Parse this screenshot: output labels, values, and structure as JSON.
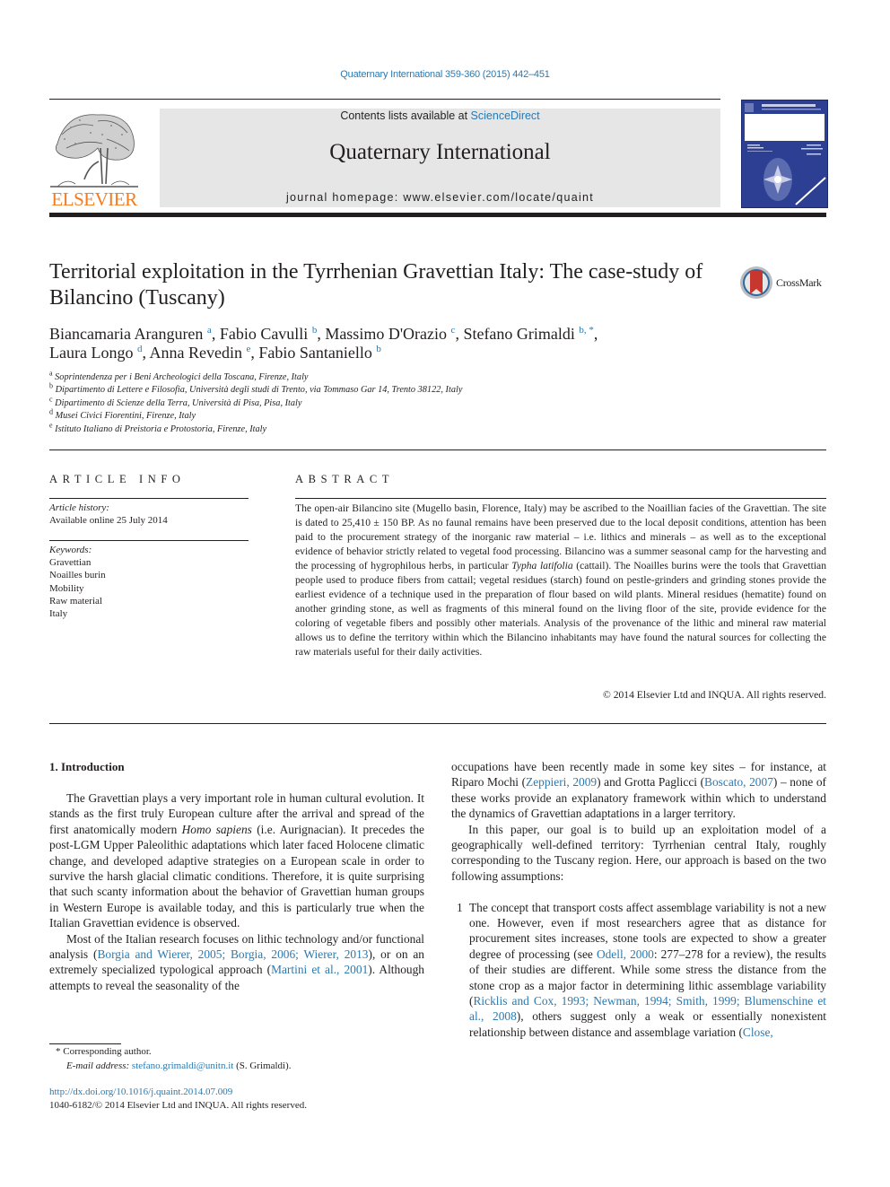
{
  "header": {
    "journal_ref": "Quaternary International 359-360 (2015) 442–451",
    "contents_prefix": "Contents lists available at ",
    "contents_link": "ScienceDirect",
    "journal_title": "Quaternary International",
    "homepage_prefix": "journal homepage: ",
    "homepage_url": "www.elsevier.com/locate/quaint",
    "publisher_logo_text": "ELSEVIER",
    "publisher_color": "#f47b20",
    "link_color": "#2a7ab0",
    "cover_color": "#2d3f93"
  },
  "article": {
    "title": "Territorial exploitation in the Tyrrhenian Gravettian Italy: The case-study of Bilancino (Tuscany)",
    "crossmark_label": "CrossMark",
    "authors": [
      {
        "name": "Biancamaria Aranguren",
        "aff": "a",
        "sep": ", "
      },
      {
        "name": "Fabio Cavulli",
        "aff": "b",
        "sep": ", "
      },
      {
        "name": "Massimo D'Orazio",
        "aff": "c",
        "sep": ", "
      },
      {
        "name": "Stefano Grimaldi",
        "aff": "b, *",
        "sep": ","
      },
      {
        "name": "Laura Longo",
        "aff": "d",
        "sep": ", "
      },
      {
        "name": "Anna Revedin",
        "aff": "e",
        "sep": ", "
      },
      {
        "name": "Fabio Santaniello",
        "aff": "b",
        "sep": ""
      }
    ],
    "affiliations": [
      {
        "key": "a",
        "text": "Soprintendenza per i Beni Archeologici della Toscana, Firenze, Italy"
      },
      {
        "key": "b",
        "text": "Dipartimento di Lettere e Filosofia, Università degli studi di Trento, via Tommaso Gar 14, Trento 38122, Italy"
      },
      {
        "key": "c",
        "text": "Dipartimento di Scienze della Terra, Università di Pisa, Pisa, Italy"
      },
      {
        "key": "d",
        "text": "Musei Civici Fiorentini, Firenze, Italy"
      },
      {
        "key": "e",
        "text": "Istituto Italiano di Preistoria e Protostoria, Firenze, Italy"
      }
    ]
  },
  "article_info": {
    "heading": "ARTICLE INFO",
    "history_label": "Article history:",
    "history_value": "Available online 25 July 2014",
    "keywords_label": "Keywords:",
    "keywords": [
      "Gravettian",
      "Noailles burin",
      "Mobility",
      "Raw material",
      "Italy"
    ]
  },
  "abstract": {
    "heading": "ABSTRACT",
    "text_before_italic": "The open-air Bilancino site (Mugello basin, Florence, Italy) may be ascribed to the Noaillian facies of the Gravettian. The site is dated to 25,410 ± 150 BP. As no faunal remains have been preserved due to the local deposit conditions, attention has been paid to the procurement strategy of the inorganic raw material – i.e. lithics and minerals – as well as to the exceptional evidence of behavior strictly related to vegetal food processing. Bilancino was a summer seasonal camp for the harvesting and the processing of hygrophilous herbs, in particular ",
    "italic": "Typha latifolia",
    "text_after_italic": " (cattail). The Noailles burins were the tools that Gravettian people used to produce fibers from cattail; vegetal residues (starch) found on pestle-grinders and grinding stones provide the earliest evidence of a technique used in the preparation of flour based on wild plants. Mineral residues (hematite) found on another grinding stone, as well as fragments of this mineral found on the living floor of the site, provide evidence for the coloring of vegetable fibers and possibly other materials. Analysis of the provenance of the lithic and mineral raw material allows us to define the territory within which the Bilancino inhabitants may have found the natural sources for collecting the raw materials useful for their daily activities.",
    "copyright": "© 2014 Elsevier Ltd and INQUA. All rights reserved."
  },
  "body": {
    "intro_heading": "1.  Introduction",
    "left_p1_a": "The Gravettian plays a very important role in human cultural evolution. It stands as the first truly European culture after the arrival and spread of the first anatomically modern ",
    "left_p1_italic": "Homo sapiens",
    "left_p1_b": " (i.e. Aurignacian). It precedes the post-LGM Upper Paleolithic adaptations which later faced Holocene climatic change, and developed adaptive strategies on a European scale in order to survive the harsh glacial climatic conditions. Therefore, it is quite surprising that such scanty information about the behavior of Gravettian human groups in Western Europe is available today, and this is particularly true when the Italian Gravettian evidence is observed.",
    "left_p2_a": "Most of the Italian research focuses on lithic technology and/or functional analysis (",
    "left_p2_cite1": "Borgia and Wierer, 2005; Borgia, 2006; Wierer, 2013",
    "left_p2_b": "), or on an extremely specialized typological approach (",
    "left_p2_cite2": "Martini et al., 2001",
    "left_p2_c": "). Although attempts to reveal the seasonality of the",
    "right_p1_a": "occupations have been recently made in some key sites – for instance, at Riparo Mochi (",
    "right_p1_cite1": "Zeppieri, 2009",
    "right_p1_b": ") and Grotta Paglicci (",
    "right_p1_cite2": "Boscato, 2007",
    "right_p1_c": ") – none of these works provide an explanatory framework within which to understand the dynamics of Gravettian adaptations in a larger territory.",
    "right_p2": "In this paper, our goal is to build up an exploitation model of a geographically well-defined territory: Tyrrhenian central Italy, roughly corresponding to the Tuscany region. Here, our approach is based on the two following assumptions:",
    "list_num": "1",
    "list_a": "The concept that transport costs affect assemblage variability is not a new one. However, even if most researchers agree that as distance for procurement sites increases, stone tools are expected to show a greater degree of processing (see ",
    "list_cite1": "Odell, 2000",
    "list_b": ": 277–278 for a review), the results of their studies are different. While some stress the distance from the stone crop as a major factor in determining lithic assemblage variability (",
    "list_cite2": "Ricklis and Cox, 1993; Newman, 1994; Smith, 1999; Blumenschine et al., 2008",
    "list_c": "), others suggest only a weak or essentially nonexistent relationship between distance and assemblage variation (",
    "list_cite3": "Close,"
  },
  "footnotes": {
    "corresponding_mark": "*",
    "corresponding_text": "Corresponding author.",
    "email_label": "E-mail address:",
    "email": "stefano.grimaldi@unitn.it",
    "email_suffix": " (S. Grimaldi).",
    "doi": "http://dx.doi.org/10.1016/j.quaint.2014.07.009",
    "issn_line": "1040-6182/© 2014 Elsevier Ltd and INQUA. All rights reserved."
  }
}
